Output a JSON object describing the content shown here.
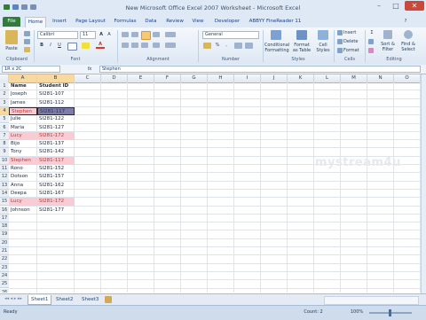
{
  "window": {
    "title": "New Microsoft Office Excel 2007 Worksheet - Microsoft Excel"
  },
  "tabs": [
    "File",
    "Home",
    "Insert",
    "Page Layout",
    "Formulas",
    "Data",
    "Review",
    "View",
    "Developer",
    "ABBYY FineReader 11"
  ],
  "ribbon": {
    "font_name": "Calibri",
    "font_size": "11",
    "number_format": "General",
    "groups": [
      "Clipboard",
      "Font",
      "Alignment",
      "Number",
      "Styles",
      "Cells",
      "Editing"
    ],
    "paste_label": "Paste",
    "cond_format_label": "Conditional Formatting",
    "format_table_label": "Format as Table",
    "cell_styles_label": "Cell Styles",
    "insert_label": "Insert",
    "delete_label": "Delete",
    "format_label": "Format",
    "sort_label": "Sort & Filter",
    "find_label": "Find & Select"
  },
  "formula_bar": {
    "name_box": "1R x 2C",
    "fx": "fx",
    "value": "Stephen"
  },
  "grid": {
    "columns": [
      "A",
      "B",
      "C",
      "D",
      "E",
      "F",
      "G",
      "H",
      "I",
      "J",
      "K",
      "L",
      "M",
      "N",
      "O"
    ],
    "row_count": 26,
    "rows": [
      [
        "Name",
        "Student ID"
      ],
      [
        "Joseph",
        "SI281-107"
      ],
      [
        "James",
        "SI281-112"
      ],
      [
        "Stephen",
        "SI281-117"
      ],
      [
        "Julie",
        "SI281-122"
      ],
      [
        "Maria",
        "SI281-127"
      ],
      [
        "Lucy",
        "SI281-172"
      ],
      [
        "Bijo",
        "SI281-137"
      ],
      [
        "Tony",
        "SI281-142"
      ],
      [
        "Stephen",
        "SI281-117"
      ],
      [
        "Rono",
        "SI281-152"
      ],
      [
        "Dotson",
        "SI281-157"
      ],
      [
        "Anna",
        "SI281-162"
      ],
      [
        "Deepa",
        "SI281-167"
      ],
      [
        "Lucy",
        "SI281-172"
      ],
      [
        "Johnson",
        "SI281-177"
      ]
    ]
  },
  "sheets": [
    "Sheet1",
    "Sheet2",
    "Sheet3"
  ],
  "status": {
    "ready": "Ready",
    "count": "Count: 2",
    "zoom": "100%"
  },
  "watermark": "mystream4u",
  "colors": {
    "file_tab": "#2f7c3b",
    "dup_fill": "#f8cbd5",
    "dup_text": "#c0392b",
    "selection": "#7e7ca8"
  }
}
